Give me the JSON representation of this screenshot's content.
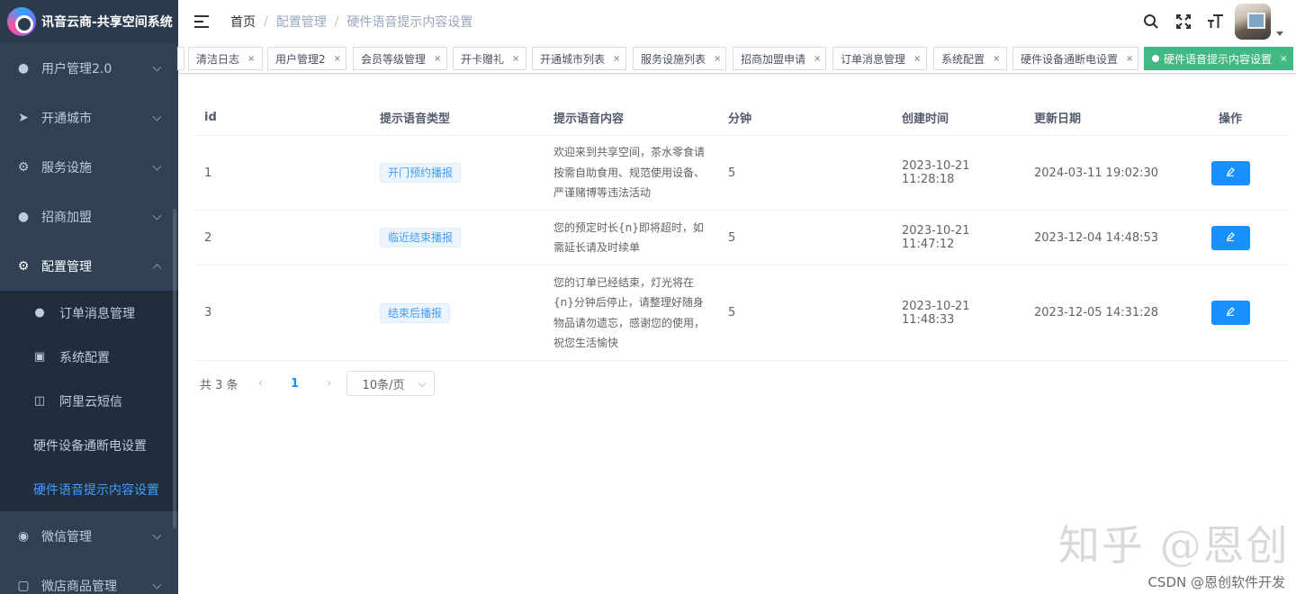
{
  "app": {
    "title": "讯音云商-共享空间系统"
  },
  "sidebar": {
    "menus": [
      {
        "label": "用户管理2.0",
        "icon": "user-icon"
      },
      {
        "label": "开通城市",
        "icon": "send-icon"
      },
      {
        "label": "服务设施",
        "icon": "gear-icon"
      },
      {
        "label": "招商加盟",
        "icon": "users-icon"
      },
      {
        "label": "配置管理",
        "icon": "gear-icon"
      }
    ],
    "config_children": [
      {
        "label": "订单消息管理",
        "icon": "user-icon"
      },
      {
        "label": "系统配置",
        "icon": "box-icon"
      },
      {
        "label": "阿里云短信",
        "icon": "briefcase-icon"
      },
      {
        "label": "硬件设备通断电设置"
      },
      {
        "label": "硬件语音提示内容设置"
      }
    ],
    "menus_after": [
      {
        "label": "微信管理",
        "icon": "wechat-icon"
      },
      {
        "label": "微店商品管理",
        "icon": "shop-icon"
      }
    ]
  },
  "navbar": {
    "breadcrumb": [
      "首页",
      "配置管理",
      "硬件语音提示内容设置"
    ],
    "separator": "/"
  },
  "tags": [
    {
      "label": "清洁日志"
    },
    {
      "label": "用户管理2"
    },
    {
      "label": "会员等级管理"
    },
    {
      "label": "开卡赠礼"
    },
    {
      "label": "开通城市列表"
    },
    {
      "label": "服务设施列表"
    },
    {
      "label": "招商加盟申请"
    },
    {
      "label": "订单消息管理"
    },
    {
      "label": "系统配置"
    },
    {
      "label": "硬件设备通断电设置"
    },
    {
      "label": "硬件语音提示内容设置",
      "active": true
    }
  ],
  "tag_close": "×",
  "table": {
    "headers": [
      "id",
      "提示语音类型",
      "提示语音内容",
      "分钟",
      "创建时间",
      "更新日期",
      "操作"
    ],
    "rows": [
      {
        "id": "1",
        "type": "开门预约播报",
        "content": "欢迎来到共享空间，茶水零食请按需自助食用、规范使用设备、严谨赌博等违法活动",
        "minutes": "5",
        "created": "2023-10-21 11:28:18",
        "updated": "2024-03-11 19:02:30"
      },
      {
        "id": "2",
        "type": "临近结束播报",
        "content": "您的预定时长{n}即将超时，如需延长请及时续单",
        "minutes": "5",
        "created": "2023-10-21 11:47:12",
        "updated": "2023-12-04 14:48:53"
      },
      {
        "id": "3",
        "type": "结束后播报",
        "content": "您的订单已经结束，灯光将在{n}分钟后停止，请整理好随身物品请勿遗忘，感谢您的使用，祝您生活愉快",
        "minutes": "5",
        "created": "2023-10-21 11:48:33",
        "updated": "2023-12-05 14:31:28"
      }
    ]
  },
  "pagination": {
    "total_text": "共 3 条",
    "current_page": "1",
    "page_size": "10条/页",
    "prev": "‹",
    "next": "›"
  },
  "watermark": {
    "text": "知乎 @恩创",
    "credit": "CSDN @恩创软件开发"
  },
  "colors": {
    "sidebar_bg": "#304156",
    "active_tag": "#42b983",
    "primary": "#1890ff",
    "active_menu_text": "#409eff"
  }
}
